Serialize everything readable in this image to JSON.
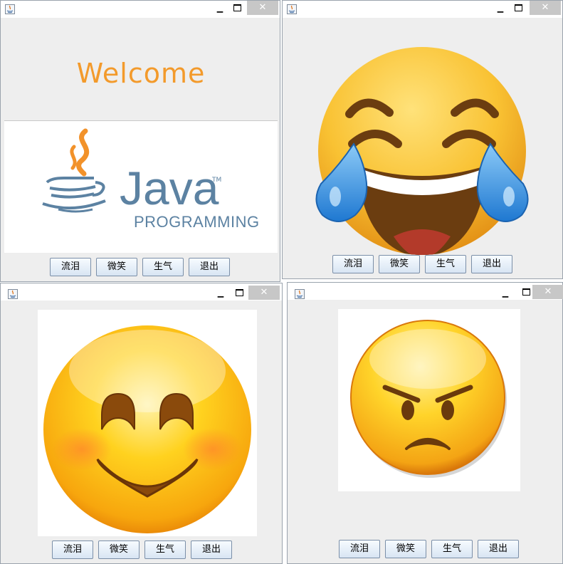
{
  "windows": [
    {
      "id": "top-left",
      "title_buttons": {
        "minimize": "▁",
        "close": "✕"
      },
      "welcome_text": "Welcome",
      "logo": {
        "word": "Java",
        "trademark": "TM",
        "subtitle": "PROGRAMMING"
      },
      "buttons": [
        "流泪",
        "微笑",
        "生气",
        "退出"
      ]
    },
    {
      "id": "top-right",
      "title_buttons": {
        "minimize": "▁",
        "close": "✕"
      },
      "image": "tears-of-joy-emoji",
      "buttons": [
        "流泪",
        "微笑",
        "生气",
        "退出"
      ]
    },
    {
      "id": "bottom-left",
      "title_buttons": {
        "minimize": "▁",
        "close": "✕"
      },
      "image": "smiling-emoji",
      "buttons": [
        "流泪",
        "微笑",
        "生气",
        "退出"
      ]
    },
    {
      "id": "bottom-right",
      "title_buttons": {
        "minimize": "▁",
        "close": "✕"
      },
      "image": "angry-emoji",
      "buttons": [
        "流泪",
        "微笑",
        "生气",
        "退出"
      ]
    }
  ],
  "colors": {
    "welcome": "#f39a2b",
    "java_blue": "#5c82a2",
    "window_bg": "#eeeeee",
    "close_button_bg": "#c7c7c7"
  }
}
